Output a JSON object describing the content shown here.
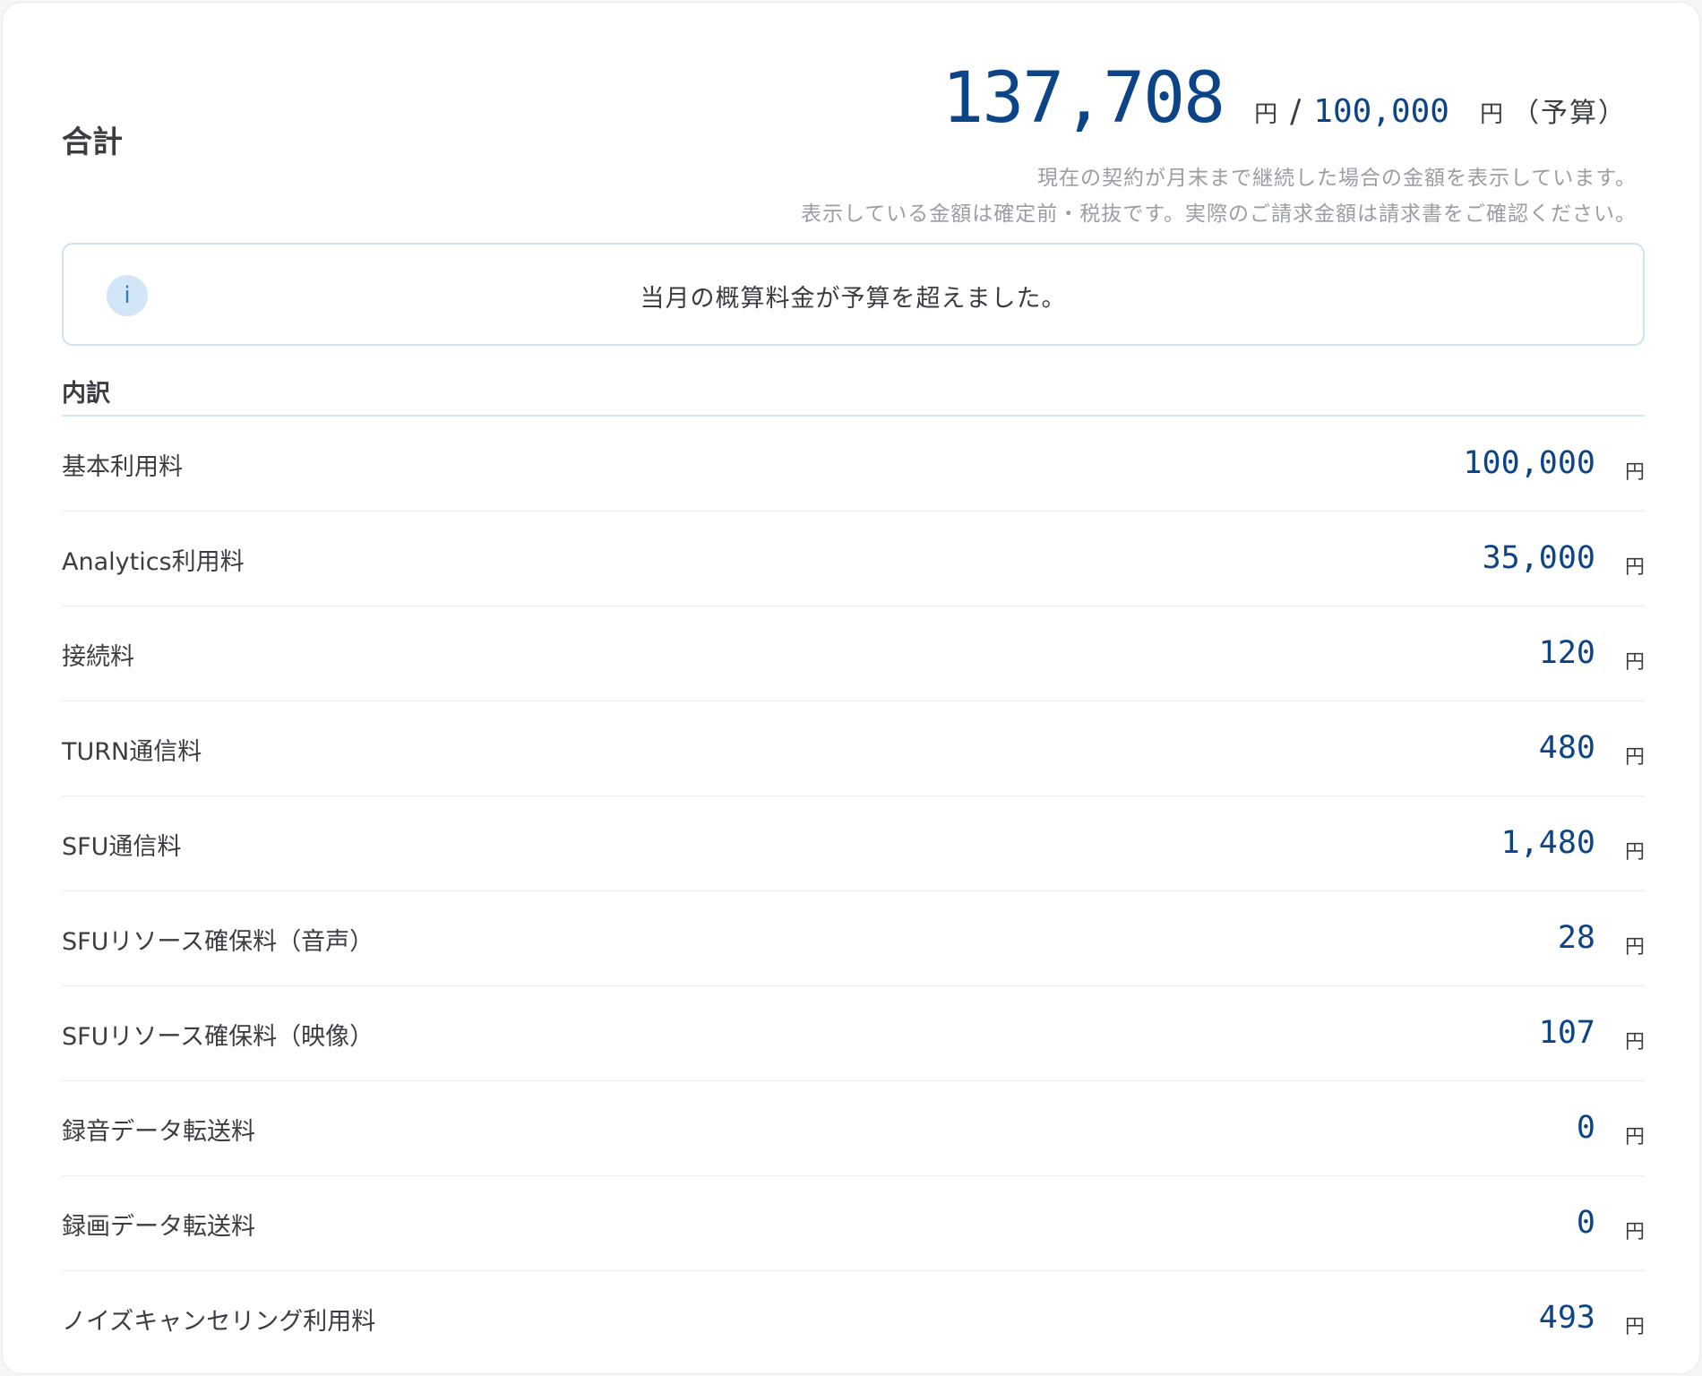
{
  "total": {
    "label": "合計",
    "amount": "137,708",
    "currency": "円",
    "separator": "/",
    "budget_amount": "100,000",
    "budget_currency": "円",
    "budget_label": "（予算）",
    "notes": [
      "現在の契約が月末まで継続した場合の金額を表示しています。",
      "表示している金額は確定前・税抜です。実際のご請求金額は請求書をご確認ください。"
    ]
  },
  "alert": {
    "icon": "info-icon",
    "icon_glyph": "i",
    "message": "当月の概算料金が予算を超えました。"
  },
  "breakdown": {
    "title": "内訳",
    "items": [
      {
        "label": "基本利用料",
        "value": "100,000",
        "unit": "円"
      },
      {
        "label": "Analytics利用料",
        "value": "35,000",
        "unit": "円"
      },
      {
        "label": "接続料",
        "value": "120",
        "unit": "円"
      },
      {
        "label": "TURN通信料",
        "value": "480",
        "unit": "円"
      },
      {
        "label": "SFU通信料",
        "value": "1,480",
        "unit": "円"
      },
      {
        "label": "SFUリソース確保料（音声）",
        "value": "28",
        "unit": "円"
      },
      {
        "label": "SFUリソース確保料（映像）",
        "value": "107",
        "unit": "円"
      },
      {
        "label": "録音データ転送料",
        "value": "0",
        "unit": "円"
      },
      {
        "label": "録画データ転送料",
        "value": "0",
        "unit": "円"
      },
      {
        "label": "ノイズキャンセリング利用料",
        "value": "493",
        "unit": "円"
      }
    ]
  },
  "colors": {
    "accent_amount": "#0d4488",
    "alert_border": "#cfe2f3",
    "info_icon_bg": "#d3e6f8",
    "note_text": "#9a9ea4"
  }
}
